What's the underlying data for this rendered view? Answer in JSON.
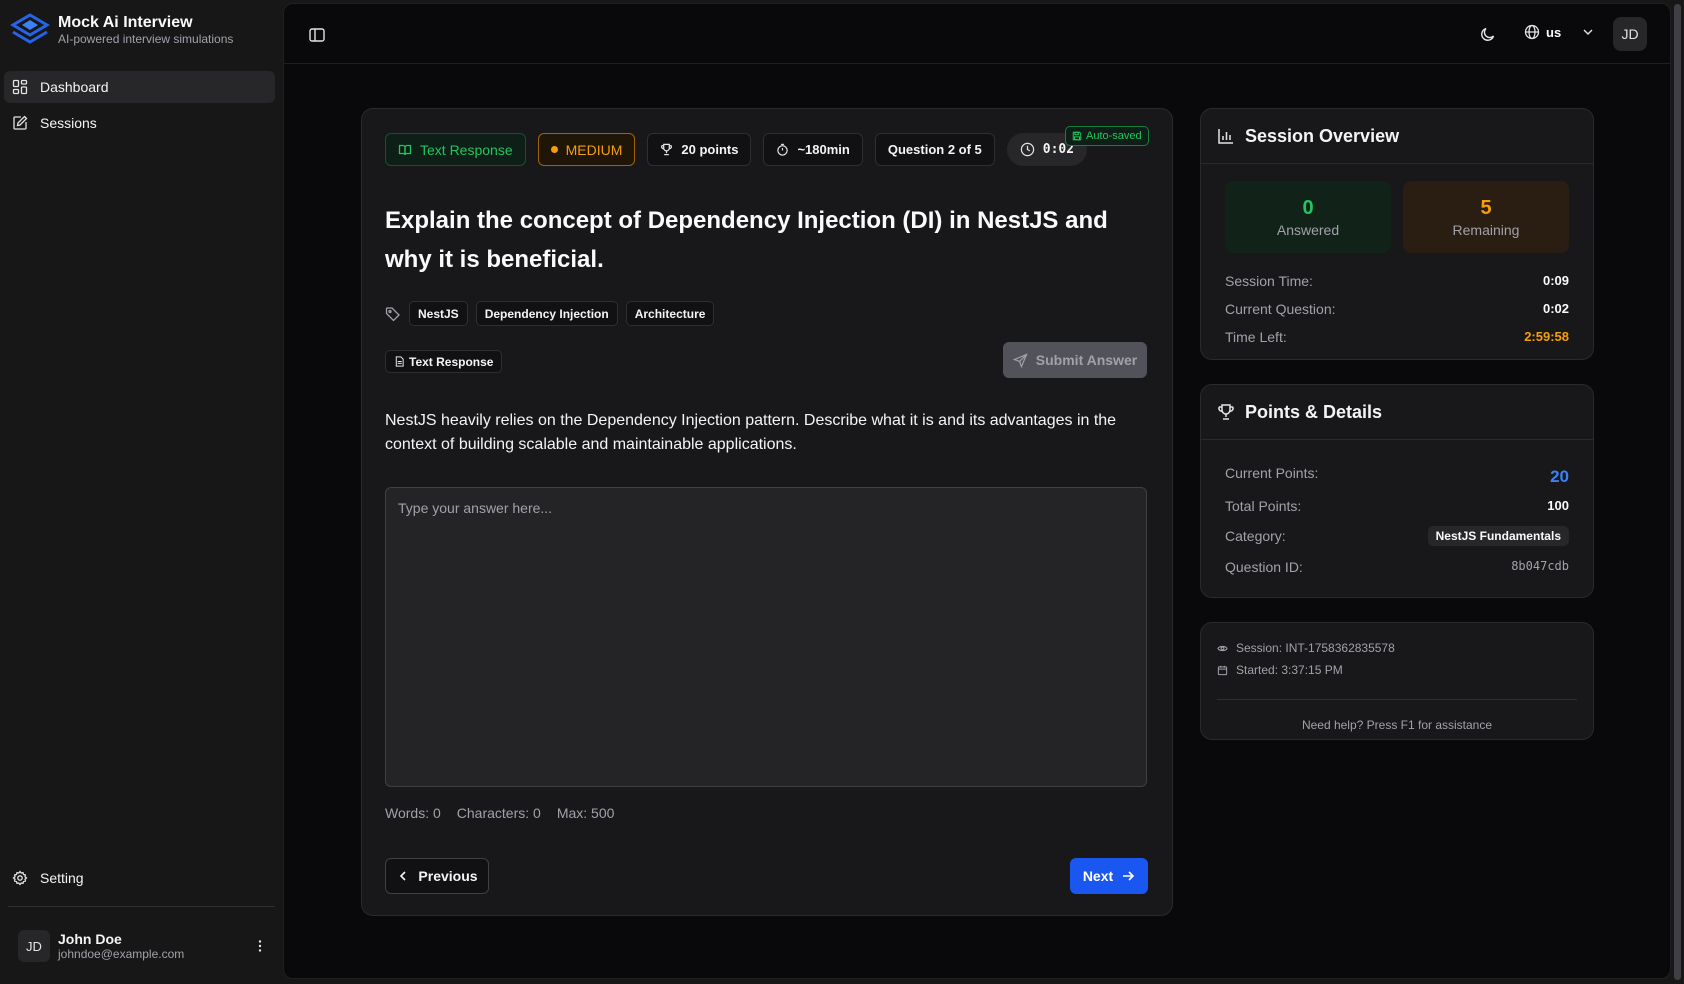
{
  "app": {
    "title": "Mock Ai Interview",
    "subtitle": "AI-powered interview simulations"
  },
  "sidebar": {
    "items": [
      {
        "label": "Dashboard",
        "icon": "dashboard-icon",
        "active": true
      },
      {
        "label": "Sessions",
        "icon": "sessions-icon",
        "active": false
      }
    ],
    "setting_label": "Setting",
    "user": {
      "initials": "JD",
      "name": "John Doe",
      "email": "johndoe@example.com"
    }
  },
  "topbar": {
    "language": "us",
    "avatar_initials": "JD"
  },
  "question": {
    "type_badge": "Text Response",
    "difficulty": "MEDIUM",
    "points": "20 points",
    "duration": "~180min",
    "progress": "Question 2 of 5",
    "timer": "0:02",
    "autosaved": "Auto-saved",
    "title": "Explain the concept of Dependency Injection (DI) in NestJS and why it is beneficial.",
    "tags": [
      "NestJS",
      "Dependency Injection",
      "Architecture"
    ],
    "response_type": "Text Response",
    "submit_label": "Submit Answer",
    "description": "NestJS heavily relies on the Dependency Injection pattern. Describe what it is and its advantages in the context of building scalable and maintainable applications.",
    "answer_placeholder": "Type your answer here...",
    "words": "Words: 0",
    "characters": "Characters: 0",
    "max": "Max: 500",
    "prev_label": "Previous",
    "next_label": "Next"
  },
  "overview": {
    "title": "Session Overview",
    "answered_count": "0",
    "answered_label": "Answered",
    "remaining_count": "5",
    "remaining_label": "Remaining",
    "session_time_label": "Session Time:",
    "session_time": "0:09",
    "current_question_label": "Current Question:",
    "current_question": "0:02",
    "time_left_label": "Time Left:",
    "time_left": "2:59:58"
  },
  "points_details": {
    "title": "Points & Details",
    "current_points_label": "Current Points:",
    "current_points": "20",
    "total_points_label": "Total Points:",
    "total_points": "100",
    "category_label": "Category:",
    "category": "NestJS Fundamentals",
    "question_id_label": "Question ID:",
    "question_id": "8b047cdb"
  },
  "session_meta": {
    "session": "Session: INT-1758362835578",
    "started": "Started: 3:37:15 PM",
    "help": "Need help? Press F1 for assistance"
  },
  "colors": {
    "accent_blue": "#1a56f0",
    "success_green": "#22c55e",
    "warning_amber": "#f59e0b"
  }
}
